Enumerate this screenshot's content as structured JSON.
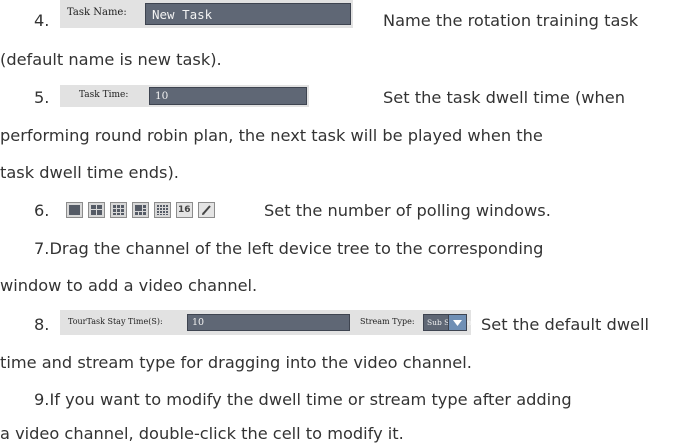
{
  "item4": {
    "number": "4.",
    "field_label": "Task Name:",
    "field_value": "New Task",
    "desc": "Name the rotation training task",
    "desc_cont": "(default name is new task)."
  },
  "item5": {
    "number": "5.",
    "field_label": "Task Time:",
    "field_value": "10",
    "desc": "Set the task dwell time (when",
    "desc_cont1": "performing round robin plan, the next task will be played when the",
    "desc_cont2": "task dwell time ends)."
  },
  "item6": {
    "number": "6.",
    "toolbar": {
      "buttons": [
        {
          "icon": "layout-1x1-icon"
        },
        {
          "icon": "layout-2x2-icon"
        },
        {
          "icon": "layout-3x3-icon"
        },
        {
          "icon": "layout-1plus5-icon"
        },
        {
          "icon": "layout-4x4-icon"
        },
        {
          "icon": "layout-16-icon",
          "label": "16"
        },
        {
          "icon": "edit-pencil-icon"
        }
      ]
    },
    "desc": "Set the number of polling windows."
  },
  "item7": {
    "line1": "7.Drag the channel of the left device tree to the corresponding",
    "line2": "window to add a video channel."
  },
  "item8": {
    "number": "8.",
    "stay_label": "TourTask Stay Time(S):",
    "stay_value": "10",
    "stream_label": "Stream Type:",
    "stream_value": "Sub Stream",
    "desc": "Set the default dwell",
    "desc_cont": "time and stream type for dragging into the video channel."
  },
  "item9": {
    "line1": "9.If you want to modify the dwell time or stream type after adding",
    "line2": "a video channel, double-click the cell to modify it."
  }
}
